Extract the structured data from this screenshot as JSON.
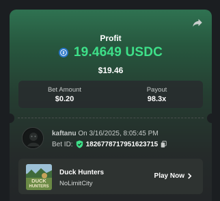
{
  "colors": {
    "accent_green": "#3ee089",
    "usdc_blue": "#2775ca",
    "verified_green": "#3ee089"
  },
  "header": {
    "share_icon": "share-icon"
  },
  "profit": {
    "label": "Profit",
    "currency_icon": "usdc-icon",
    "amount": "19.4649 USDC",
    "fiat": "$19.46"
  },
  "stats": {
    "bet_amount_label": "Bet Amount",
    "bet_amount_value": "$0.20",
    "payout_label": "Payout",
    "payout_value": "98.3x"
  },
  "bet": {
    "user": "kaftanu",
    "placed_at": "On 3/16/2025, 8:05:45 PM",
    "id_label": "Bet ID:",
    "id": "1826778717951623715",
    "verified_icon": "shield-check-icon",
    "copy_icon": "copy-icon"
  },
  "game": {
    "thumb_text_1": "DUCK",
    "thumb_text_2": "HUNTERS",
    "name": "Duck Hunters",
    "provider": "NoLimitCity",
    "play_label": "Play Now",
    "play_icon": "chevron-right-icon"
  }
}
